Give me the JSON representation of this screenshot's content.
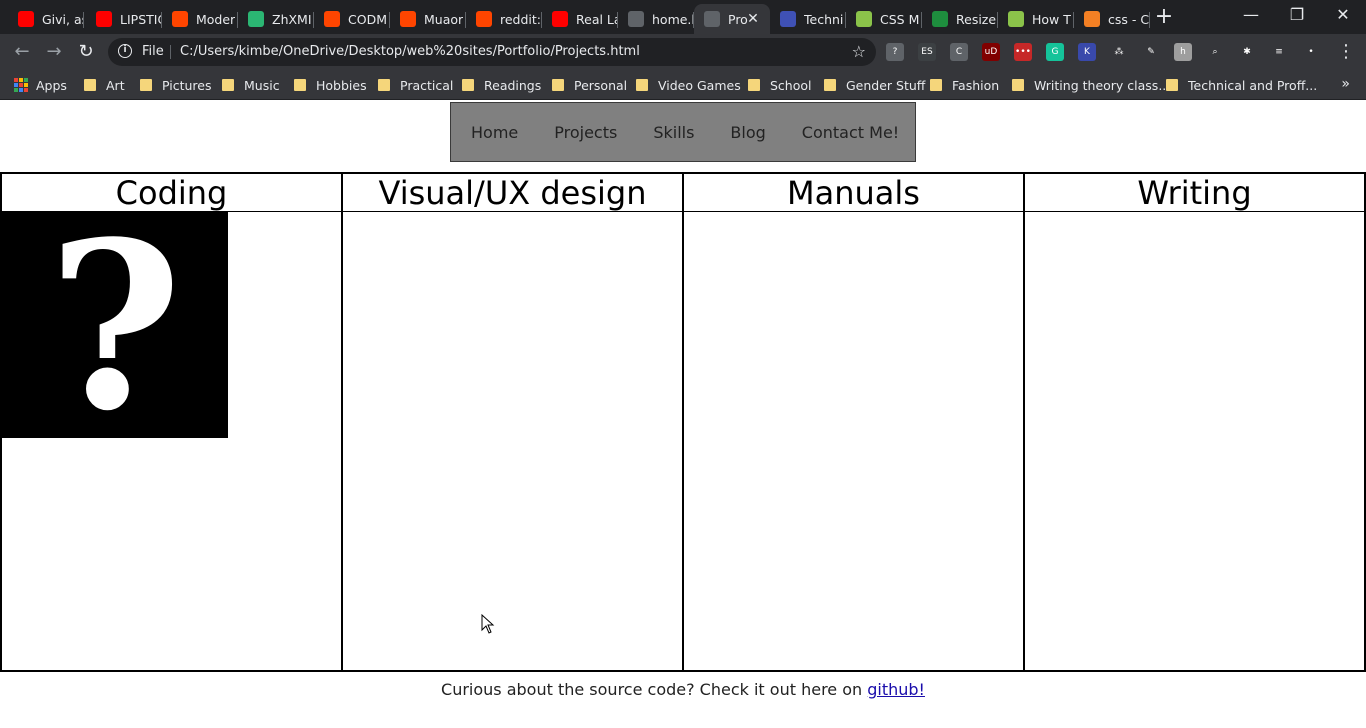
{
  "browser": {
    "tabs": [
      {
        "title": "Givi, as",
        "favicon": "youtube-icon",
        "color": "#ff0000"
      },
      {
        "title": "LIPSTIC",
        "favicon": "youtube-icon",
        "color": "#ff0000"
      },
      {
        "title": "Moder",
        "favicon": "reddit-icon",
        "color": "#ff4500"
      },
      {
        "title": "ZhXMI",
        "favicon": "app-icon",
        "color": "#2bb673"
      },
      {
        "title": "CODM",
        "favicon": "reddit-icon",
        "color": "#ff4500"
      },
      {
        "title": "Muaor",
        "favicon": "reddit-icon",
        "color": "#ff4500"
      },
      {
        "title": "reddit:",
        "favicon": "reddit-icon",
        "color": "#ff4500"
      },
      {
        "title": "Real La",
        "favicon": "youtube-icon",
        "color": "#ff0000"
      },
      {
        "title": "home.h",
        "favicon": "globe-icon",
        "color": "#5f6368"
      },
      {
        "title": "Pro",
        "favicon": "globe-icon",
        "color": "#5f6368"
      },
      {
        "title": "Techni",
        "favicon": "calendar-icon",
        "color": "#3f51b5"
      },
      {
        "title": "CSS M",
        "favicon": "chart-icon",
        "color": "#8bc34a"
      },
      {
        "title": "Resize",
        "favicon": "resize-icon",
        "color": "#1e8e3e"
      },
      {
        "title": "How T",
        "favicon": "chart-icon",
        "color": "#8bc34a"
      },
      {
        "title": "css - C",
        "favicon": "stackoverflow-icon",
        "color": "#f48024"
      }
    ],
    "url_scheme": "File",
    "url": "C:/Users/kimbe/OneDrive/Desktop/web%20sites/Portfolio/Projects.html",
    "bookmarks": [
      "Apps",
      "Art",
      "Pictures",
      "Music",
      "Hobbies",
      "Practical",
      "Readings",
      "Personal",
      "Video Games",
      "School",
      "Gender Stuff",
      "Fashion",
      "Writing theory class...",
      "Technical and Proff..."
    ],
    "extensions": [
      {
        "name": "help-extension-icon",
        "label": "?",
        "color": "#5f6368"
      },
      {
        "name": "es-extension-icon",
        "label": "ES",
        "color": "#3c4043"
      },
      {
        "name": "c-extension-icon",
        "label": "C",
        "color": "#5f6368"
      },
      {
        "name": "ublock-extension-icon",
        "label": "uD",
        "color": "#800000"
      },
      {
        "name": "dots-extension-icon",
        "label": "•••",
        "color": "#c62828"
      },
      {
        "name": "grammarly-extension-icon",
        "label": "G",
        "color": "#15c39a"
      },
      {
        "name": "k-extension-icon",
        "label": "K",
        "color": "#3949ab"
      },
      {
        "name": "asana-extension-icon",
        "label": "⁂",
        "color": "#35363a"
      },
      {
        "name": "pen-extension-icon",
        "label": "✎",
        "color": "#35363a"
      },
      {
        "name": "h-extension-icon",
        "label": "h",
        "color": "#9e9e9e"
      },
      {
        "name": "zoom-extension-icon",
        "label": "⌕",
        "color": "#35363a"
      },
      {
        "name": "puzzle-extension-icon",
        "label": "✱",
        "color": "#35363a"
      },
      {
        "name": "playlist-extension-icon",
        "label": "≡",
        "color": "#35363a"
      },
      {
        "name": "profile-extension-icon",
        "label": "•",
        "color": "#35363a"
      }
    ]
  },
  "site": {
    "nav": [
      "Home",
      "Projects",
      "Skills",
      "Blog",
      "Contact Me!"
    ],
    "columns": [
      "Coding",
      "Visual/UX design",
      "Manuals",
      "Writing"
    ],
    "placeholder_glyph": "?",
    "footer_text": "Curious about the source code? Check it out here on ",
    "footer_link": "github!"
  }
}
